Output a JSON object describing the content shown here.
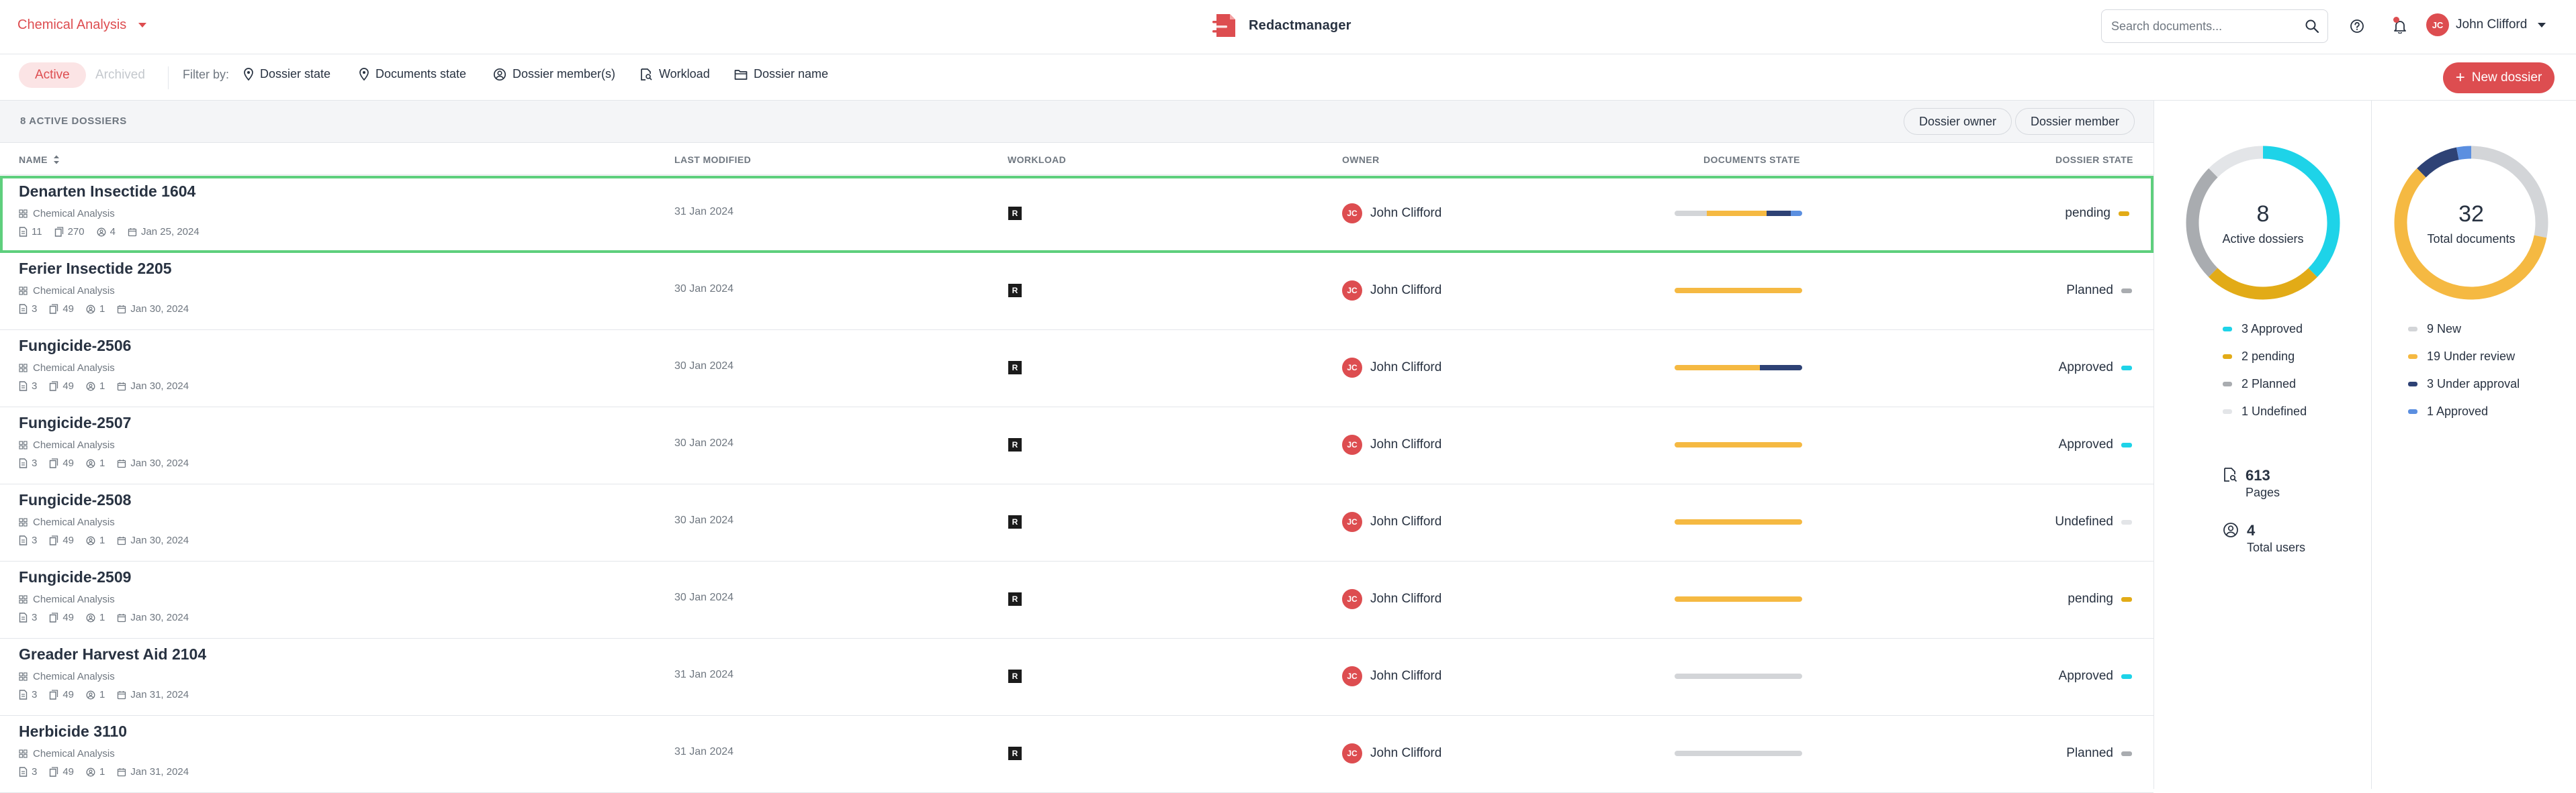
{
  "header": {
    "workspace": "Chemical Analysis",
    "brand": "Redactmanager",
    "search_placeholder": "Search documents...",
    "user_initials": "JC",
    "user_name": "John Clifford"
  },
  "filterbar": {
    "tab_active": "Active",
    "tab_archived": "Archived",
    "filter_by": "Filter by:",
    "filters": [
      "Dossier state",
      "Documents state",
      "Dossier member(s)",
      "Workload",
      "Dossier name"
    ],
    "new_button": "New dossier"
  },
  "table": {
    "count_label": "8 ACTIVE DOSSIERS",
    "pill_owner": "Dossier owner",
    "pill_member": "Dossier member",
    "columns": {
      "name": "NAME",
      "last_modified": "LAST MODIFIED",
      "workload": "WORKLOAD",
      "owner": "OWNER",
      "documents_state": "DOCUMENTS STATE",
      "dossier_state": "DOSSIER STATE"
    },
    "rows": [
      {
        "name": "Denarten Insectide 1604",
        "template": "Chemical Analysis",
        "docs": "11",
        "pages": "270",
        "members": "4",
        "date": "Jan 25, 2024",
        "modified": "31 Jan 2024",
        "workload": "R",
        "owner_initials": "JC",
        "owner": "John Clifford",
        "doc_state": [
          [
            "#d3d5d8",
            25
          ],
          [
            "#f5b942",
            47
          ],
          [
            "#2e4275",
            19
          ],
          [
            "#5b8fe0",
            9
          ]
        ],
        "state": "pending",
        "state_color": "#e2ab17"
      },
      {
        "name": "Ferier Insectide 2205",
        "template": "Chemical Analysis",
        "docs": "3",
        "pages": "49",
        "members": "1",
        "date": "Jan 30, 2024",
        "modified": "30 Jan 2024",
        "workload": "R",
        "owner_initials": "JC",
        "owner": "John Clifford",
        "doc_state": [
          [
            "#f5b942",
            100
          ]
        ],
        "state": "Planned",
        "state_color": "#a9acb0"
      },
      {
        "name": "Fungicide-2506",
        "template": "Chemical Analysis",
        "docs": "3",
        "pages": "49",
        "members": "1",
        "date": "Jan 30, 2024",
        "modified": "30 Jan 2024",
        "workload": "R",
        "owner_initials": "JC",
        "owner": "John Clifford",
        "doc_state": [
          [
            "#f5b942",
            67
          ],
          [
            "#2e4275",
            33
          ]
        ],
        "state": "Approved",
        "state_color": "#1ed3e8"
      },
      {
        "name": "Fungicide-2507",
        "template": "Chemical Analysis",
        "docs": "3",
        "pages": "49",
        "members": "1",
        "date": "Jan 30, 2024",
        "modified": "30 Jan 2024",
        "workload": "R",
        "owner_initials": "JC",
        "owner": "John Clifford",
        "doc_state": [
          [
            "#f5b942",
            100
          ]
        ],
        "state": "Approved",
        "state_color": "#1ed3e8"
      },
      {
        "name": "Fungicide-2508",
        "template": "Chemical Analysis",
        "docs": "3",
        "pages": "49",
        "members": "1",
        "date": "Jan 30, 2024",
        "modified": "30 Jan 2024",
        "workload": "R",
        "owner_initials": "JC",
        "owner": "John Clifford",
        "doc_state": [
          [
            "#f5b942",
            100
          ]
        ],
        "state": "Undefined",
        "state_color": "#e3e5e8"
      },
      {
        "name": "Fungicide-2509",
        "template": "Chemical Analysis",
        "docs": "3",
        "pages": "49",
        "members": "1",
        "date": "Jan 30, 2024",
        "modified": "30 Jan 2024",
        "workload": "R",
        "owner_initials": "JC",
        "owner": "John Clifford",
        "doc_state": [
          [
            "#f5b942",
            100
          ]
        ],
        "state": "pending",
        "state_color": "#e2ab17"
      },
      {
        "name": "Greader Harvest Aid 2104",
        "template": "Chemical Analysis",
        "docs": "3",
        "pages": "49",
        "members": "1",
        "date": "Jan 31, 2024",
        "modified": "31 Jan 2024",
        "workload": "R",
        "owner_initials": "JC",
        "owner": "John Clifford",
        "doc_state": [
          [
            "#d3d5d8",
            100
          ]
        ],
        "state": "Approved",
        "state_color": "#1ed3e8"
      },
      {
        "name": "Herbicide 3110",
        "template": "Chemical Analysis",
        "docs": "3",
        "pages": "49",
        "members": "1",
        "date": "Jan 31, 2024",
        "modified": "31 Jan 2024",
        "workload": "R",
        "owner_initials": "JC",
        "owner": "John Clifford",
        "doc_state": [
          [
            "#d3d5d8",
            100
          ]
        ],
        "state": "Planned",
        "state_color": "#a9acb0"
      }
    ]
  },
  "stats": {
    "dossiers": {
      "number": "8",
      "label": "Active dossiers",
      "segments": [
        {
          "label": "3 Approved",
          "value": 3,
          "color": "#1ed3e8"
        },
        {
          "label": "2 pending",
          "value": 2,
          "color": "#e2ab17"
        },
        {
          "label": "2 Planned",
          "value": 2,
          "color": "#a9acb0"
        },
        {
          "label": "1 Undefined",
          "value": 1,
          "color": "#e3e5e8"
        }
      ]
    },
    "documents": {
      "number": "32",
      "label": "Total documents",
      "segments": [
        {
          "label": "9 New",
          "value": 9,
          "color": "#d3d5d8"
        },
        {
          "label": "19 Under review",
          "value": 19,
          "color": "#f5b942"
        },
        {
          "label": "3 Under approval",
          "value": 3,
          "color": "#2e4275"
        },
        {
          "label": "1 Approved",
          "value": 1,
          "color": "#5b8fe0"
        }
      ]
    },
    "pages_value": "613",
    "pages_label": "Pages",
    "users_value": "4",
    "users_label": "Total users"
  }
}
